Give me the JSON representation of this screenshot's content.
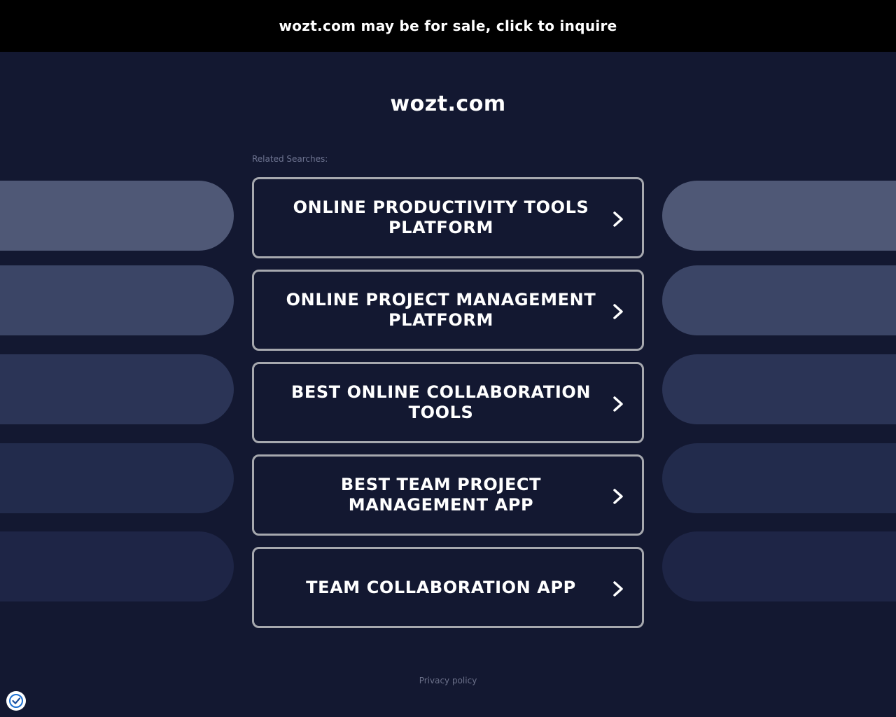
{
  "banner": {
    "text": "wozt.com may be for sale, click to inquire"
  },
  "header": {
    "domain": "wozt.com"
  },
  "related": {
    "label": "Related Searches:",
    "links": [
      {
        "line1": "ONLINE PRODUCTIVITY TOOLS",
        "line2": "PLATFORM"
      },
      {
        "line1": "ONLINE PROJECT MANAGEMENT",
        "line2": "PLATFORM"
      },
      {
        "line1": "BEST ONLINE COLLABORATION",
        "line2": "TOOLS"
      },
      {
        "line1": "BEST TEAM PROJECT",
        "line2": "MANAGEMENT APP"
      },
      {
        "line1": "TEAM COLLABORATION APP",
        "line2": ""
      }
    ]
  },
  "decor": {
    "pill_colors": [
      "#4f5876",
      "#3b4566",
      "#2b3456",
      "#222b4c",
      "#1e2546"
    ]
  },
  "footer": {
    "privacy_label": "Privacy policy"
  },
  "badge": {
    "icon": "privacy-badge-icon"
  }
}
